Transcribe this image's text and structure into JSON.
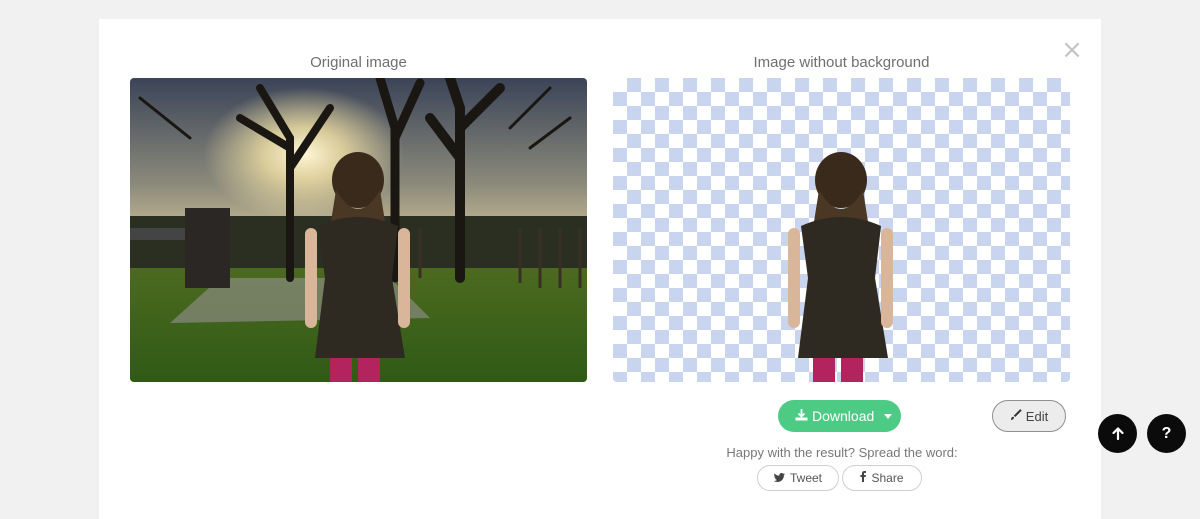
{
  "dialog": {
    "close_symbol": "×",
    "original": {
      "title": "Original image"
    },
    "result": {
      "title": "Image without background"
    },
    "actions": {
      "download_label": "Download",
      "edit_label": "Edit"
    },
    "share": {
      "prompt": "Happy with the result? Spread the word:",
      "tweet_label": "Tweet",
      "share_label": "Share"
    }
  },
  "floating_buttons": {
    "help_symbol": "?"
  },
  "colors": {
    "accent_green": "#4dcb85",
    "checker_blue": "#c9d4ef",
    "fab_black": "#0b0b0b"
  },
  "icons": [
    "close-icon",
    "download-icon",
    "caret-down-icon",
    "brush-icon",
    "twitter-icon",
    "facebook-icon",
    "arrow-up-icon"
  ]
}
